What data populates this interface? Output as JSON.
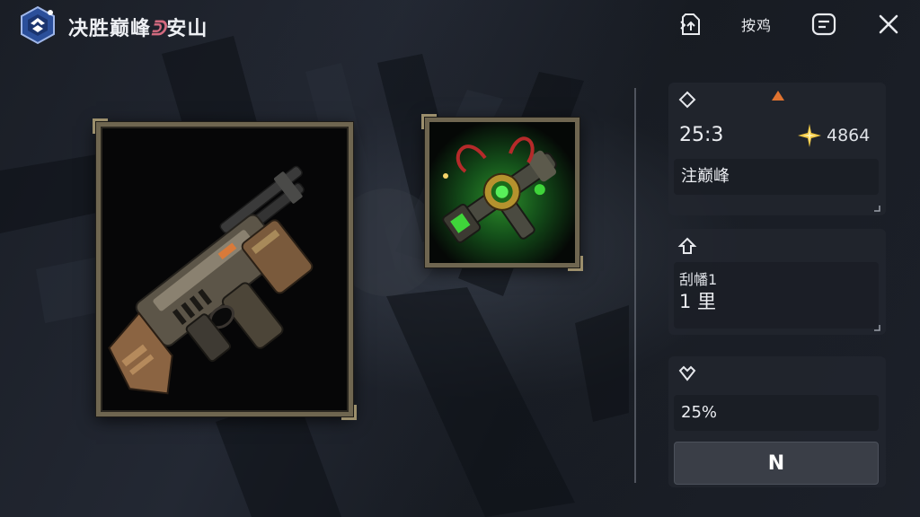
{
  "header": {
    "title_main": "决胜巅峰",
    "title_mark": "ᕲ",
    "title_sub": "安山",
    "text_button": "按鸡"
  },
  "panel": {
    "stats_card": {
      "left_value": "25:3",
      "right_value": "4864",
      "field_text": "注巅峰"
    },
    "info_card": {
      "line1": "刮幡1",
      "line2": "1 里"
    },
    "rate_card": {
      "percent": "25%",
      "button_label": "N"
    }
  },
  "icons": {
    "logo": "game-logo-icon",
    "share": "share-icon",
    "chat": "chat-icon",
    "close": "close-icon",
    "card1": "diamond-icon",
    "card2": "up-arrow-icon",
    "card3": "heart-diamond-icon",
    "warning": "warning-triangle-icon",
    "star": "star-burst-icon"
  },
  "colors": {
    "accent_orange": "#e07330",
    "title_accent": "#d36a7f",
    "frame_border": "#6f6650",
    "gem_green": "#3fd43a",
    "star_gold": "#f0c640"
  }
}
